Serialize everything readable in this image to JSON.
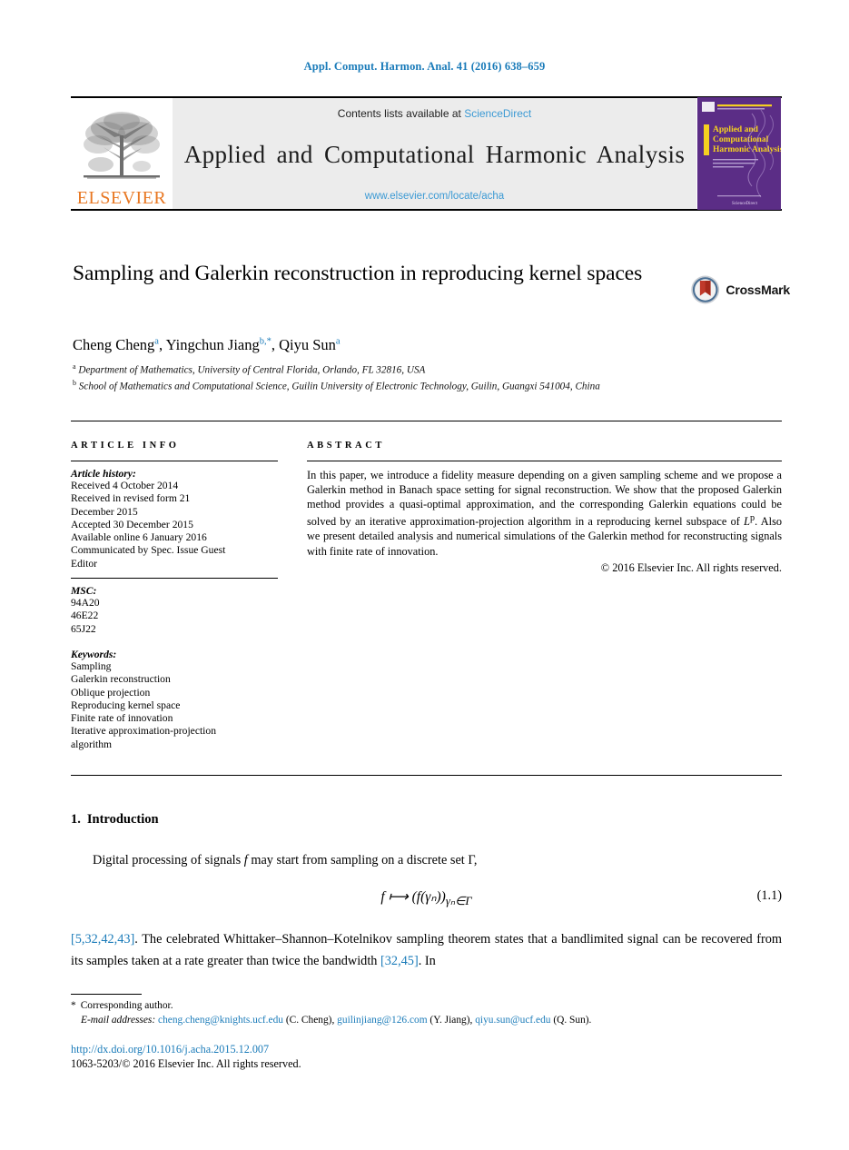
{
  "running_head": "Appl. Comput. Harmon. Anal. 41 (2016) 638–659",
  "masthead": {
    "publisher": "ELSEVIER",
    "contents_prefix": "Contents lists available at ",
    "contents_link": "ScienceDirect",
    "journal_title": "Applied and Computational Harmonic Analysis",
    "journal_url": "www.elsevier.com/locate/acha",
    "cover_title_line1": "Applied and",
    "cover_title_line2": "Computational",
    "cover_title_line3": "Harmonic Analysis",
    "cover_bg": "#5b2d86",
    "cover_text_color": "#f5d020"
  },
  "article": {
    "title": "Sampling and Galerkin reconstruction in reproducing kernel spaces",
    "crossmark_label": "CrossMark",
    "authors": [
      {
        "name": "Cheng Cheng",
        "marks": "a"
      },
      {
        "name": "Yingchun Jiang",
        "marks": "b,*"
      },
      {
        "name": "Qiyu Sun",
        "marks": "a"
      }
    ],
    "affiliations": [
      {
        "mark": "a",
        "text": "Department of Mathematics, University of Central Florida, Orlando, FL 32816, USA"
      },
      {
        "mark": "b",
        "text": "School of Mathematics and Computational Science, Guilin University of Electronic Technology, Guilin, Guangxi 541004, China"
      }
    ]
  },
  "info": {
    "heading": "ARTICLE INFO",
    "history_label": "Article history:",
    "history": [
      "Received 4 October 2014",
      "Received in revised form 21",
      "December 2015",
      "Accepted 30 December 2015",
      "Available online 6 January 2016",
      "Communicated by Spec. Issue Guest",
      "Editor"
    ],
    "msc_label": "MSC:",
    "msc": [
      "94A20",
      "46E22",
      "65J22"
    ],
    "keywords_label": "Keywords:",
    "keywords": [
      "Sampling",
      "Galerkin reconstruction",
      "Oblique projection",
      "Reproducing kernel space",
      "Finite rate of innovation",
      "Iterative approximation-projection",
      "algorithm"
    ]
  },
  "abstract": {
    "heading": "ABSTRACT",
    "text_part1": "In this paper, we introduce a fidelity measure depending on a given sampling scheme and we propose a Galerkin method in Banach space setting for signal reconstruction. We show that the proposed Galerkin method provides a quasi-optimal approximation, and the corresponding Galerkin equations could be solved by an iterative approximation-projection algorithm in a reproducing kernel subspace of ",
    "math_lp": "L",
    "math_lp_sup": "p",
    "text_part2": ". Also we present detailed analysis and numerical simulations of the Galerkin method for reconstructing signals with finite rate of innovation.",
    "copyright": "© 2016 Elsevier Inc. All rights reserved."
  },
  "body": {
    "section_number": "1.",
    "section_title": "Introduction",
    "para1_a": "Digital processing of signals ",
    "para1_f": "f",
    "para1_b": " may start from sampling on a discrete set Γ,",
    "equation_text": "f ⟼ (f(γₙ))",
    "equation_sub": "γₙ∈Γ",
    "equation_number": "(1.1)",
    "para2_ref1": "[5,32,42,43]",
    "para2_a": ". The celebrated Whittaker–Shannon–Kotelnikov sampling theorem states that a bandlimited signal can be recovered from its samples taken at a rate greater than twice the bandwidth ",
    "para2_ref2": "[32,45]",
    "para2_b": ". In"
  },
  "footnote": {
    "star": "*",
    "corresponding": "Corresponding author.",
    "email_label": "E-mail addresses:",
    "emails": [
      {
        "address": "cheng.cheng@knights.ucf.edu",
        "who": "(C. Cheng),"
      },
      {
        "address": "guilinjiang@126.com",
        "who": "(Y. Jiang),"
      },
      {
        "address": "qiyu.sun@ucf.edu",
        "who": "(Q. Sun)."
      }
    ]
  },
  "doi": {
    "url": "http://dx.doi.org/10.1016/j.acha.2015.12.007",
    "issn_line": "1063-5203/© 2016 Elsevier Inc. All rights reserved."
  },
  "colors": {
    "link": "#1a7bb9",
    "sciencedirect": "#3c9ad4",
    "elsevier_orange": "#E87722",
    "masthead_bg": "#ececec"
  }
}
